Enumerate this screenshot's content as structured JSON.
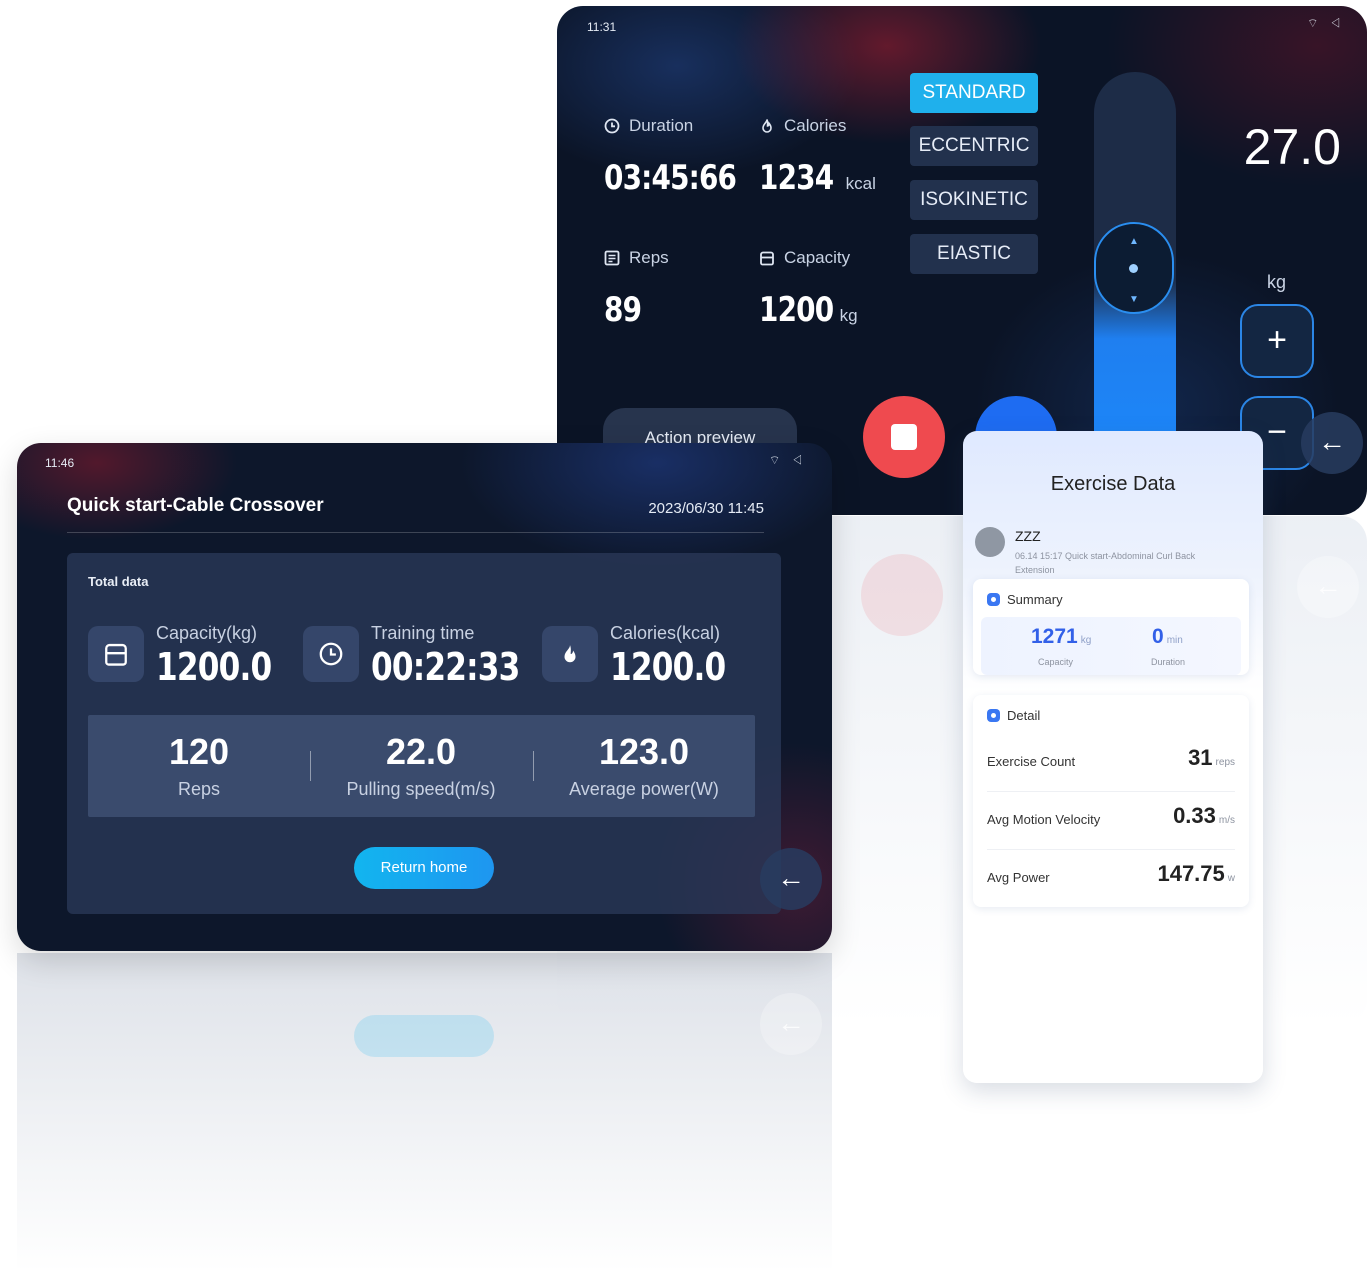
{
  "workout_screen": {
    "status_time": "11:31",
    "metrics": [
      {
        "label": "Duration",
        "value": "03:45:66",
        "unit": "",
        "icon": "clock-icon"
      },
      {
        "label": "Calories",
        "value": "1234",
        "unit": "kcal",
        "icon": "flame-icon"
      },
      {
        "label": "Reps",
        "value": "89",
        "unit": "",
        "icon": "list-icon"
      },
      {
        "label": "Capacity",
        "value": "1200",
        "unit": "kg",
        "icon": "weight-icon"
      }
    ],
    "modes": [
      "STANDARD",
      "ECCENTRIC",
      "ISOKINETIC",
      "EIASTIC"
    ],
    "active_mode": "STANDARD",
    "weight_value": "27.0",
    "weight_unit": "kg",
    "plus_label": "+",
    "minus_label": "−",
    "action_preview": "Action preview",
    "accent": "#1fb0ec",
    "stop_color": "#ef4a4f"
  },
  "result_screen": {
    "status_time": "11:46",
    "title": "Quick start-Cable Crossover",
    "datetime": "2023/06/30 11:45",
    "total_label": "Total data",
    "big_stats": [
      {
        "label": "Capacity(kg)",
        "value": "1200.0",
        "icon": "weight-icon"
      },
      {
        "label": "Training time",
        "value": "00:22:33",
        "icon": "clock-icon"
      },
      {
        "label": "Calories(kcal)",
        "value": "1200.0",
        "icon": "flame-icon"
      }
    ],
    "sub_stats": [
      {
        "value": "120",
        "label": "Reps"
      },
      {
        "value": "22.0",
        "label": "Pulling speed(m/s)"
      },
      {
        "value": "123.0",
        "label": "Average power(W)"
      }
    ],
    "return_home": "Return home"
  },
  "phone": {
    "title": "Exercise Data",
    "user_name": "ZZZ",
    "user_sub": "06.14 15:17 Quick start-Abdominal Curl Back Extension",
    "summary_label": "Summary",
    "summary": [
      {
        "value": "1271",
        "unit": "kg",
        "label": "Capacity"
      },
      {
        "value": "0",
        "unit": "min",
        "label": "Duration"
      }
    ],
    "detail_label": "Detail",
    "details": [
      {
        "label": "Exercise Count",
        "value": "31",
        "unit": "reps"
      },
      {
        "label": "Avg Motion Velocity",
        "value": "0.33",
        "unit": "m/s"
      },
      {
        "label": "Avg Power",
        "value": "147.75",
        "unit": "w"
      }
    ]
  }
}
